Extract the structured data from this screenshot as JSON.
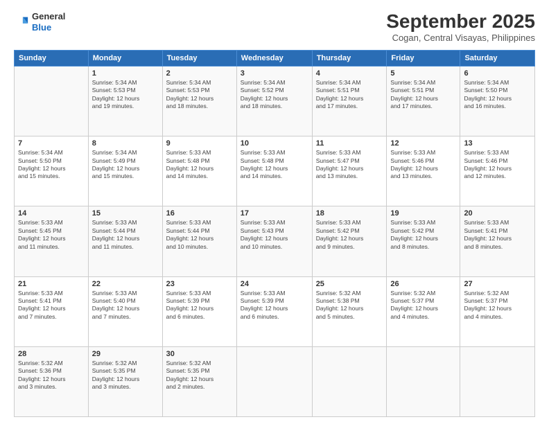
{
  "header": {
    "logo_line1": "General",
    "logo_line2": "Blue",
    "month": "September 2025",
    "location": "Cogan, Central Visayas, Philippines"
  },
  "days_of_week": [
    "Sunday",
    "Monday",
    "Tuesday",
    "Wednesday",
    "Thursday",
    "Friday",
    "Saturday"
  ],
  "weeks": [
    [
      {
        "day": "",
        "info": ""
      },
      {
        "day": "1",
        "info": "Sunrise: 5:34 AM\nSunset: 5:53 PM\nDaylight: 12 hours\nand 19 minutes."
      },
      {
        "day": "2",
        "info": "Sunrise: 5:34 AM\nSunset: 5:53 PM\nDaylight: 12 hours\nand 18 minutes."
      },
      {
        "day": "3",
        "info": "Sunrise: 5:34 AM\nSunset: 5:52 PM\nDaylight: 12 hours\nand 18 minutes."
      },
      {
        "day": "4",
        "info": "Sunrise: 5:34 AM\nSunset: 5:51 PM\nDaylight: 12 hours\nand 17 minutes."
      },
      {
        "day": "5",
        "info": "Sunrise: 5:34 AM\nSunset: 5:51 PM\nDaylight: 12 hours\nand 17 minutes."
      },
      {
        "day": "6",
        "info": "Sunrise: 5:34 AM\nSunset: 5:50 PM\nDaylight: 12 hours\nand 16 minutes."
      }
    ],
    [
      {
        "day": "7",
        "info": "Sunrise: 5:34 AM\nSunset: 5:50 PM\nDaylight: 12 hours\nand 15 minutes."
      },
      {
        "day": "8",
        "info": "Sunrise: 5:34 AM\nSunset: 5:49 PM\nDaylight: 12 hours\nand 15 minutes."
      },
      {
        "day": "9",
        "info": "Sunrise: 5:33 AM\nSunset: 5:48 PM\nDaylight: 12 hours\nand 14 minutes."
      },
      {
        "day": "10",
        "info": "Sunrise: 5:33 AM\nSunset: 5:48 PM\nDaylight: 12 hours\nand 14 minutes."
      },
      {
        "day": "11",
        "info": "Sunrise: 5:33 AM\nSunset: 5:47 PM\nDaylight: 12 hours\nand 13 minutes."
      },
      {
        "day": "12",
        "info": "Sunrise: 5:33 AM\nSunset: 5:46 PM\nDaylight: 12 hours\nand 13 minutes."
      },
      {
        "day": "13",
        "info": "Sunrise: 5:33 AM\nSunset: 5:46 PM\nDaylight: 12 hours\nand 12 minutes."
      }
    ],
    [
      {
        "day": "14",
        "info": "Sunrise: 5:33 AM\nSunset: 5:45 PM\nDaylight: 12 hours\nand 11 minutes."
      },
      {
        "day": "15",
        "info": "Sunrise: 5:33 AM\nSunset: 5:44 PM\nDaylight: 12 hours\nand 11 minutes."
      },
      {
        "day": "16",
        "info": "Sunrise: 5:33 AM\nSunset: 5:44 PM\nDaylight: 12 hours\nand 10 minutes."
      },
      {
        "day": "17",
        "info": "Sunrise: 5:33 AM\nSunset: 5:43 PM\nDaylight: 12 hours\nand 10 minutes."
      },
      {
        "day": "18",
        "info": "Sunrise: 5:33 AM\nSunset: 5:42 PM\nDaylight: 12 hours\nand 9 minutes."
      },
      {
        "day": "19",
        "info": "Sunrise: 5:33 AM\nSunset: 5:42 PM\nDaylight: 12 hours\nand 8 minutes."
      },
      {
        "day": "20",
        "info": "Sunrise: 5:33 AM\nSunset: 5:41 PM\nDaylight: 12 hours\nand 8 minutes."
      }
    ],
    [
      {
        "day": "21",
        "info": "Sunrise: 5:33 AM\nSunset: 5:41 PM\nDaylight: 12 hours\nand 7 minutes."
      },
      {
        "day": "22",
        "info": "Sunrise: 5:33 AM\nSunset: 5:40 PM\nDaylight: 12 hours\nand 7 minutes."
      },
      {
        "day": "23",
        "info": "Sunrise: 5:33 AM\nSunset: 5:39 PM\nDaylight: 12 hours\nand 6 minutes."
      },
      {
        "day": "24",
        "info": "Sunrise: 5:33 AM\nSunset: 5:39 PM\nDaylight: 12 hours\nand 6 minutes."
      },
      {
        "day": "25",
        "info": "Sunrise: 5:32 AM\nSunset: 5:38 PM\nDaylight: 12 hours\nand 5 minutes."
      },
      {
        "day": "26",
        "info": "Sunrise: 5:32 AM\nSunset: 5:37 PM\nDaylight: 12 hours\nand 4 minutes."
      },
      {
        "day": "27",
        "info": "Sunrise: 5:32 AM\nSunset: 5:37 PM\nDaylight: 12 hours\nand 4 minutes."
      }
    ],
    [
      {
        "day": "28",
        "info": "Sunrise: 5:32 AM\nSunset: 5:36 PM\nDaylight: 12 hours\nand 3 minutes."
      },
      {
        "day": "29",
        "info": "Sunrise: 5:32 AM\nSunset: 5:35 PM\nDaylight: 12 hours\nand 3 minutes."
      },
      {
        "day": "30",
        "info": "Sunrise: 5:32 AM\nSunset: 5:35 PM\nDaylight: 12 hours\nand 2 minutes."
      },
      {
        "day": "",
        "info": ""
      },
      {
        "day": "",
        "info": ""
      },
      {
        "day": "",
        "info": ""
      },
      {
        "day": "",
        "info": ""
      }
    ]
  ]
}
